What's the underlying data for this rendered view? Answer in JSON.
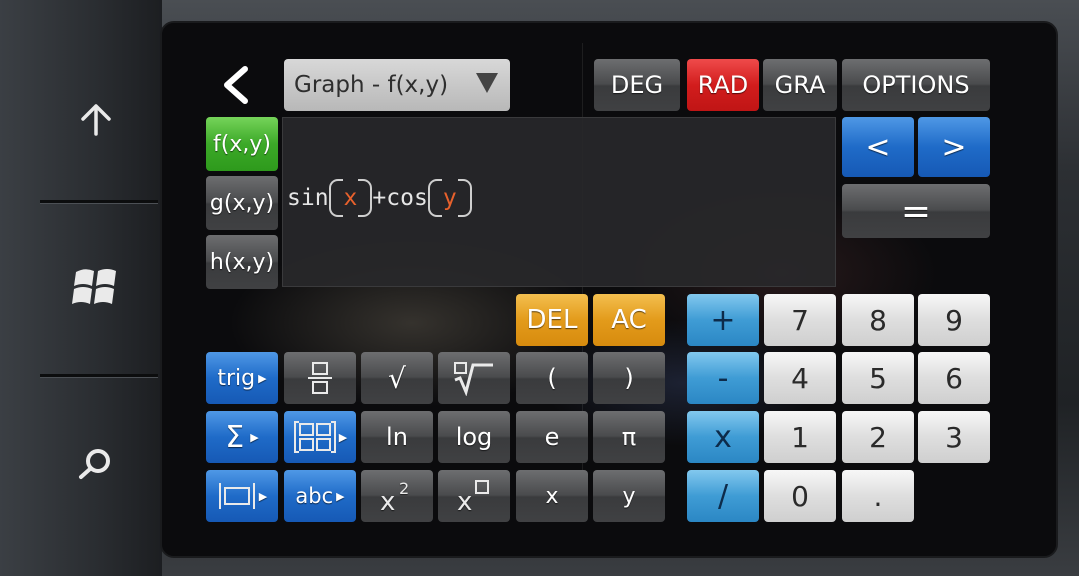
{
  "header": {
    "mode_dropdown": "Graph - f(x,y)",
    "angle_modes": [
      "DEG",
      "RAD",
      "GRA"
    ],
    "active_angle_mode": "RAD",
    "options_label": "OPTIONS"
  },
  "functions": [
    "f(x,y)",
    "g(x,y)",
    "h(x,y)"
  ],
  "active_function": "f(x,y)",
  "expression": {
    "func1": "sin",
    "arg1": "x",
    "op": "+",
    "func2": "cos",
    "arg2": "y"
  },
  "cursor_nav": {
    "left": "<",
    "right": ">",
    "equals": "="
  },
  "edit": {
    "del": "DEL",
    "ac": "AC"
  },
  "func_keys": {
    "trig": "trig",
    "sqrt": "√",
    "open_paren": "(",
    "close_paren": ")",
    "ln": "ln",
    "log": "log",
    "e": "e",
    "pi": "π",
    "abc": "abc",
    "x_var": "x",
    "y_var": "y"
  },
  "operators": [
    "+",
    "-",
    "x",
    "/"
  ],
  "digits": {
    "row1": [
      "7",
      "8",
      "9"
    ],
    "row2": [
      "4",
      "5",
      "6"
    ],
    "row3": [
      "1",
      "2",
      "3"
    ],
    "zero": "0",
    "dot": "."
  },
  "colors": {
    "active_mode": "#d21d1d",
    "active_function": "#3ca928",
    "operator_keys": "#3f9cd5",
    "edit_keys": "#e39b1b",
    "nav_keys": "#1f6bc8",
    "variable_text": "#e8612c"
  }
}
